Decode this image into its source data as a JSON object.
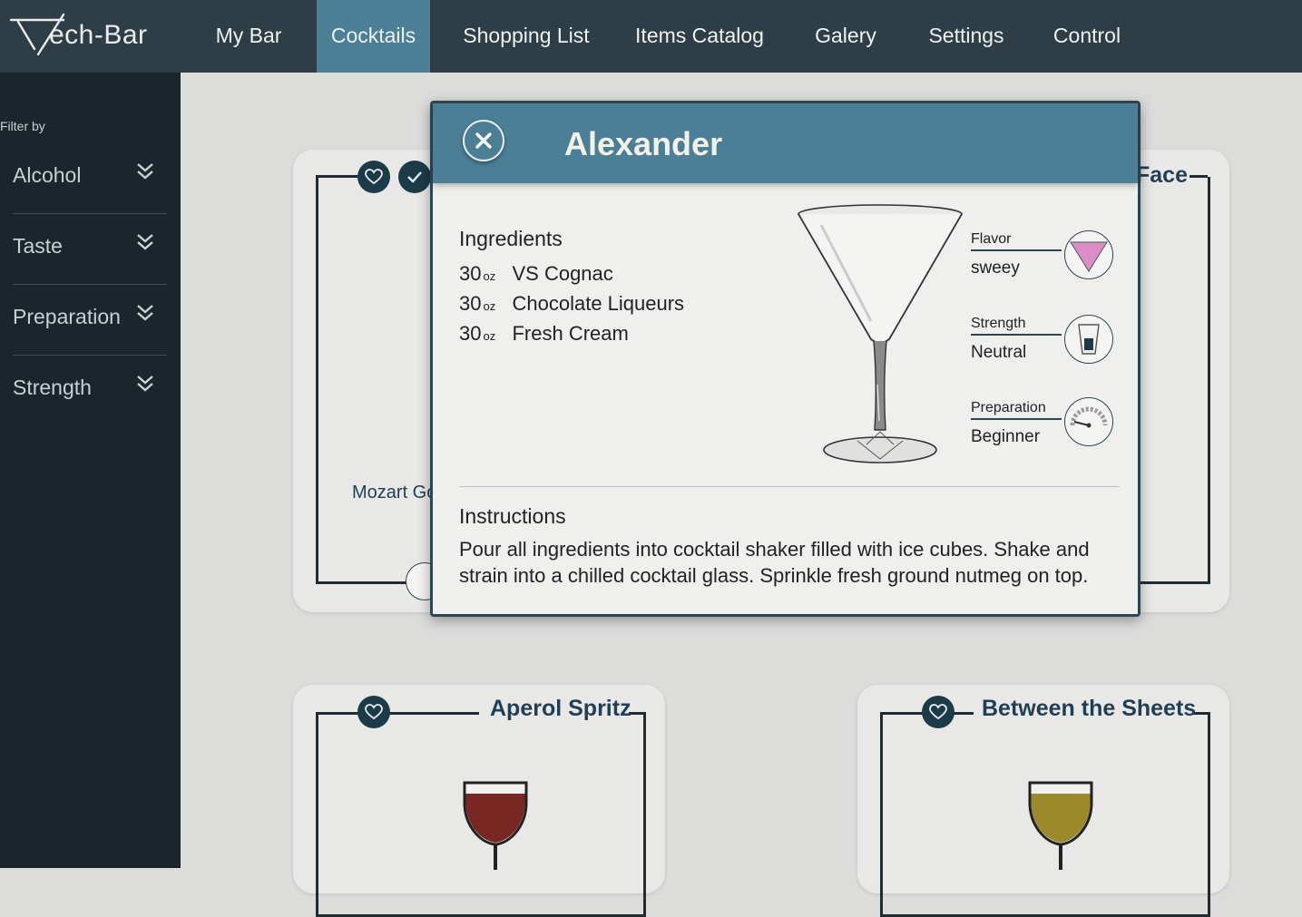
{
  "app": {
    "logo_text": "ech-Bar"
  },
  "nav": {
    "items": [
      {
        "label": "My Bar",
        "active": false
      },
      {
        "label": "Cocktails",
        "active": true
      },
      {
        "label": "Shopping List",
        "active": false
      },
      {
        "label": "Items Catalog",
        "active": false
      },
      {
        "label": "Galery",
        "active": false
      },
      {
        "label": "Settings",
        "active": false
      },
      {
        "label": "Control",
        "active": false
      }
    ]
  },
  "sidebar": {
    "filter_label": "Filter by",
    "filters": [
      {
        "label": "Alcohol",
        "icon": "double-chevron-down-icon"
      },
      {
        "label": "Taste",
        "icon": "double-chevron-down-icon"
      },
      {
        "label": "Preparation",
        "icon": "double-chevron-down-icon"
      },
      {
        "label": "Strength",
        "icon": "double-chevron-down-icon"
      }
    ]
  },
  "cards": {
    "left_top": {
      "partial_text": "Mozart Go"
    },
    "right_top": {
      "partial_title": "Face"
    },
    "bottom_left": {
      "title": "Aperol Spritz",
      "liquid_color": "#7a2622"
    },
    "bottom_right": {
      "title": "Between the Sheets",
      "liquid_color": "#9a8a2a"
    }
  },
  "modal": {
    "title": "Alexander",
    "close_icon": "close-icon",
    "ingredients_heading": "Ingredients",
    "ingredients": [
      {
        "qty": "30",
        "unit": "oz",
        "name": "VS Cognac"
      },
      {
        "qty": "30",
        "unit": "oz",
        "name": "Chocolate Liqueurs"
      },
      {
        "qty": "30",
        "unit": "oz",
        "name": "Fresh Cream"
      }
    ],
    "stats": {
      "flavor": {
        "label": "Flavor",
        "value": "sweey",
        "icon": "pink-triangle-icon",
        "color": "#d98fc6"
      },
      "strength": {
        "label": "Strength",
        "value": "Neutral",
        "icon": "shot-glass-icon"
      },
      "preparation": {
        "label": "Preparation",
        "value": "Beginner",
        "icon": "gauge-icon"
      }
    },
    "instructions_heading": "Instructions",
    "instructions": "Pour all ingredients into cocktail shaker filled with ice cubes. Shake and strain into a chilled cocktail glass. Sprinkle fresh ground nutmeg on top."
  },
  "colors": {
    "topbar": "#2d3e46",
    "accent": "#4a7f95",
    "sidebar": "#1b262c",
    "card_badge": "#1c3b48"
  }
}
